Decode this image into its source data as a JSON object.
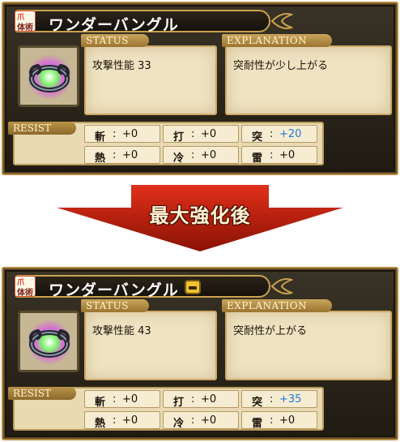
{
  "before": {
    "item_name": "ワンダーバングル",
    "type_badge": {
      "claw": "爪",
      "label": "体術"
    },
    "status_tab": "STATUS",
    "status_text": "攻撃性能 33",
    "explanation_tab": "EXPLANATION",
    "explanation_text": "突耐性が少し上がる",
    "resist_tab": "RESIST",
    "resist": [
      {
        "key": "斬",
        "sep": ":",
        "value": "+0",
        "highlight": false
      },
      {
        "key": "打",
        "sep": ":",
        "value": "+0",
        "highlight": false
      },
      {
        "key": "突",
        "sep": ":",
        "value": "+20",
        "highlight": true
      },
      {
        "key": "熱",
        "sep": ":",
        "value": "+0",
        "highlight": false
      },
      {
        "key": "冷",
        "sep": ":",
        "value": "+0",
        "highlight": false
      },
      {
        "key": "雷",
        "sep": ":",
        "value": "+0",
        "highlight": false
      }
    ]
  },
  "arrow_label": "最大強化後",
  "after": {
    "item_name": "ワンダーバングル",
    "type_badge": {
      "claw": "爪",
      "label": "体術"
    },
    "upgrade_icon": "max-upgrade-icon",
    "status_tab": "STATUS",
    "status_text": "攻撃性能 43",
    "explanation_tab": "EXPLANATION",
    "explanation_text": "突耐性が上がる",
    "resist_tab": "RESIST",
    "resist": [
      {
        "key": "斬",
        "sep": ":",
        "value": "+0",
        "highlight": false
      },
      {
        "key": "打",
        "sep": ":",
        "value": "+0",
        "highlight": false
      },
      {
        "key": "突",
        "sep": ":",
        "value": "+35",
        "highlight": true
      },
      {
        "key": "熱",
        "sep": ":",
        "value": "+0",
        "highlight": false
      },
      {
        "key": "冷",
        "sep": ":",
        "value": "+0",
        "highlight": false
      },
      {
        "key": "雷",
        "sep": ":",
        "value": "+0",
        "highlight": false
      }
    ]
  },
  "colors": {
    "frame_gold": "#b38a3c",
    "arrow_red": "#b31a08",
    "resist_up_blue": "#1e7ed8"
  }
}
